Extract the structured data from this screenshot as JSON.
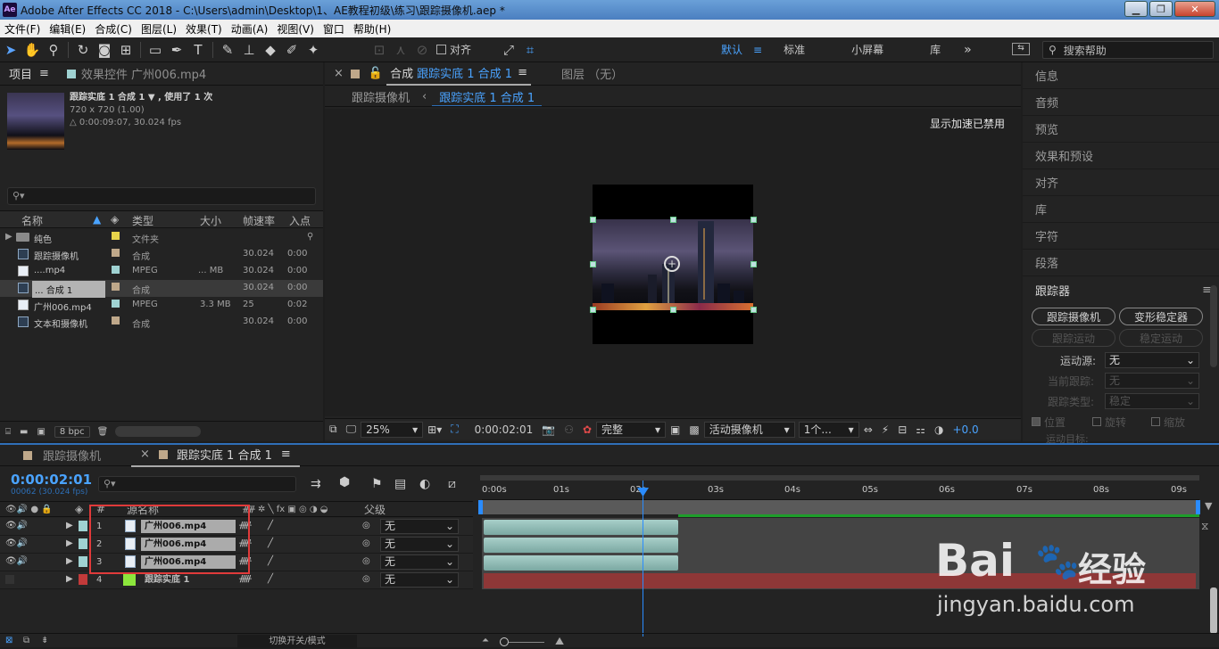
{
  "window": {
    "title": "Adobe After Effects CC 2018 - C:\\Users\\admin\\Desktop\\1、AE教程初级\\练习\\跟踪摄像机.aep *",
    "logo": "Ae"
  },
  "menu": [
    "文件(F)",
    "编辑(E)",
    "合成(C)",
    "图层(L)",
    "效果(T)",
    "动画(A)",
    "视图(V)",
    "窗口",
    "帮助(H)"
  ],
  "toolbar": {
    "align_label": "对齐",
    "workspaces": [
      "默认",
      "标准",
      "小屏幕",
      "库"
    ],
    "help_search": "搜索帮助"
  },
  "project": {
    "tab_project": "项目",
    "tab_effects": "效果控件 广州006.mp4",
    "selected_name": "跟踪实底 1 合成 1 ▼ , 使用了 1 次",
    "selected_dims": "720 x 720 (1.00)",
    "selected_duration": "△ 0:00:09:07, 30.024 fps",
    "columns": [
      "名称",
      "类型",
      "大小",
      "帧速率",
      "入点"
    ],
    "items": [
      {
        "name": "纯色",
        "type": "文件夹",
        "size": "",
        "fps": "",
        "in": "",
        "color": "#e6d34a"
      },
      {
        "name": "跟踪摄像机",
        "type": "合成",
        "size": "",
        "fps": "30.024",
        "in": "0:00",
        "color": "#bfa88a"
      },
      {
        "name": "....mp4",
        "type": "MPEG",
        "size": "... MB",
        "fps": "30.024",
        "in": "0:00",
        "color": "#9fd2d2"
      },
      {
        "name": "... 合成 1",
        "type": "合成",
        "size": "",
        "fps": "30.024",
        "in": "0:00",
        "color": "#bfa88a"
      },
      {
        "name": "广州006.mp4",
        "type": "MPEG",
        "size": "3.3 MB",
        "fps": "25",
        "in": "0:02",
        "color": "#9fd2d2"
      },
      {
        "name": "文本和摄像机",
        "type": "合成",
        "size": "",
        "fps": "30.024",
        "in": "0:00",
        "color": "#bfa88a"
      }
    ],
    "bpc": "8 bpc"
  },
  "comp": {
    "tab_label": "合成",
    "tab_comp": "跟踪实底 1 合成 1",
    "tab_layer": "图层 （无）",
    "crumb_1": "跟踪摄像机",
    "crumb_2": "跟踪实底 1 合成 1",
    "accel_msg": "显示加速已禁用",
    "zoom": "25%",
    "time": "0:00:02:01",
    "quality": "完整",
    "camera": "活动摄像机",
    "views": "1个...",
    "exposure": "+0.0"
  },
  "right": {
    "items": [
      "信息",
      "音频",
      "预览",
      "效果和预设",
      "对齐",
      "库",
      "字符",
      "段落"
    ],
    "tracker_title": "跟踪器",
    "track_camera": "跟踪摄像机",
    "warp_stabilizer": "变形稳定器",
    "track_motion": "跟踪运动",
    "stabilize_motion": "稳定运动",
    "motion_source_label": "运动源:",
    "motion_source": "无",
    "current_track_label": "当前跟踪:",
    "current_track": "无",
    "track_type_label": "跟踪类型:",
    "track_type": "稳定",
    "opt_position": "位置",
    "opt_rotation": "旋转",
    "opt_scale": "缩放",
    "motion_target": "运动目标:"
  },
  "timeline": {
    "tab_1": "跟踪摄像机",
    "tab_2": "跟踪实底 1 合成 1",
    "timecode": "0:00:02:01",
    "frames": "00062 (30.024 fps)",
    "col_num": "#",
    "col_source": "源名称",
    "col_parent": "父级",
    "ruler": [
      "0:00s",
      "01s",
      "02s",
      "03s",
      "04s",
      "05s",
      "06s",
      "07s",
      "08s",
      "09s"
    ],
    "layers": [
      {
        "num": "1",
        "name": "广州006.mp4",
        "parent": "无",
        "color": "#9fd2d2"
      },
      {
        "num": "2",
        "name": "广州006.mp4",
        "parent": "无",
        "color": "#9fd2d2"
      },
      {
        "num": "3",
        "name": "广州006.mp4",
        "parent": "无",
        "color": "#9fd2d2"
      },
      {
        "num": "4",
        "name": "跟踪实底 1",
        "parent": "无",
        "color": "#8ce63c"
      }
    ],
    "footer_toggle": "切换开关/模式"
  },
  "watermark": {
    "brand": "Bai",
    "brand2": "经验",
    "url": "jingyan.baidu.com"
  }
}
